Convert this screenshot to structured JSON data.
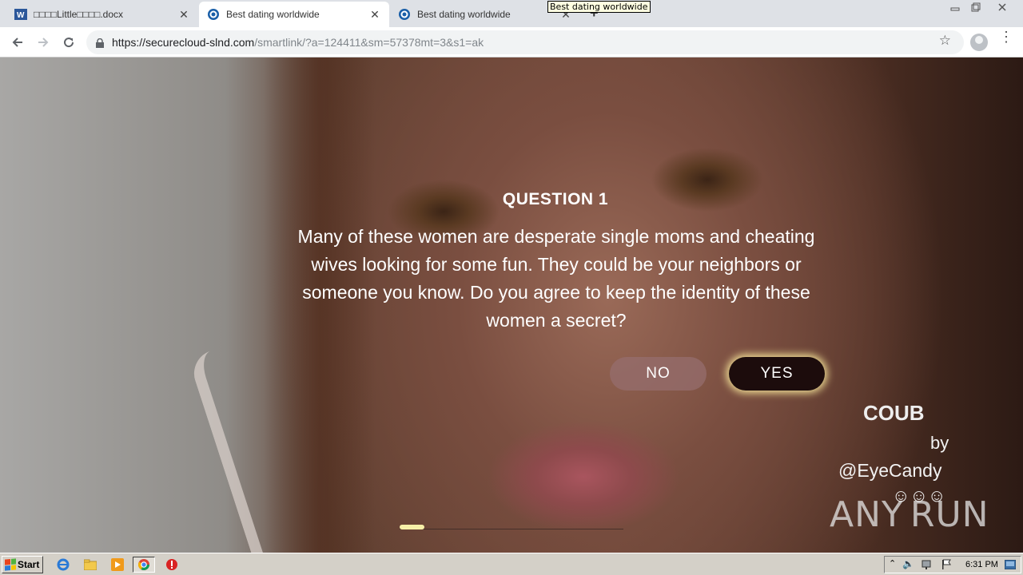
{
  "browser": {
    "tabs": [
      {
        "title": "□□□□Little□□□□.docx",
        "active": false
      },
      {
        "title": "Best dating worldwide",
        "active": true
      },
      {
        "title": "Best dating worldwide",
        "active": false
      }
    ],
    "tooltip": "Best dating worldwide",
    "url_host": "https://securecloud-slnd.com",
    "url_path": "/smartlink/?a=124411&sm=57378mt=3&s1=ak"
  },
  "page": {
    "question_title": "QUESTION 1",
    "question_text": "Many of these women are desperate single moms and cheating wives looking for some fun. They could be your neighbors or someone you know. Do you agree to keep the identity of these women a secret?",
    "no_label": "NO",
    "yes_label": "YES",
    "progress_fraction": 0.11,
    "watermark": {
      "brand": "COUB",
      "by": "by",
      "handle": "@EyeCandy",
      "emojis": "☺☺☺"
    },
    "anyrun": "ANY RUN"
  },
  "taskbar": {
    "start_label": "Start",
    "clock": "6:31 PM"
  },
  "colors": {
    "yes_button": "#1c0c0c",
    "yes_glow": "#fff0a0",
    "progress_fill": "#f6f0a8",
    "tab_bar": "#dee1e6",
    "taskbar": "#d4d0c8"
  }
}
